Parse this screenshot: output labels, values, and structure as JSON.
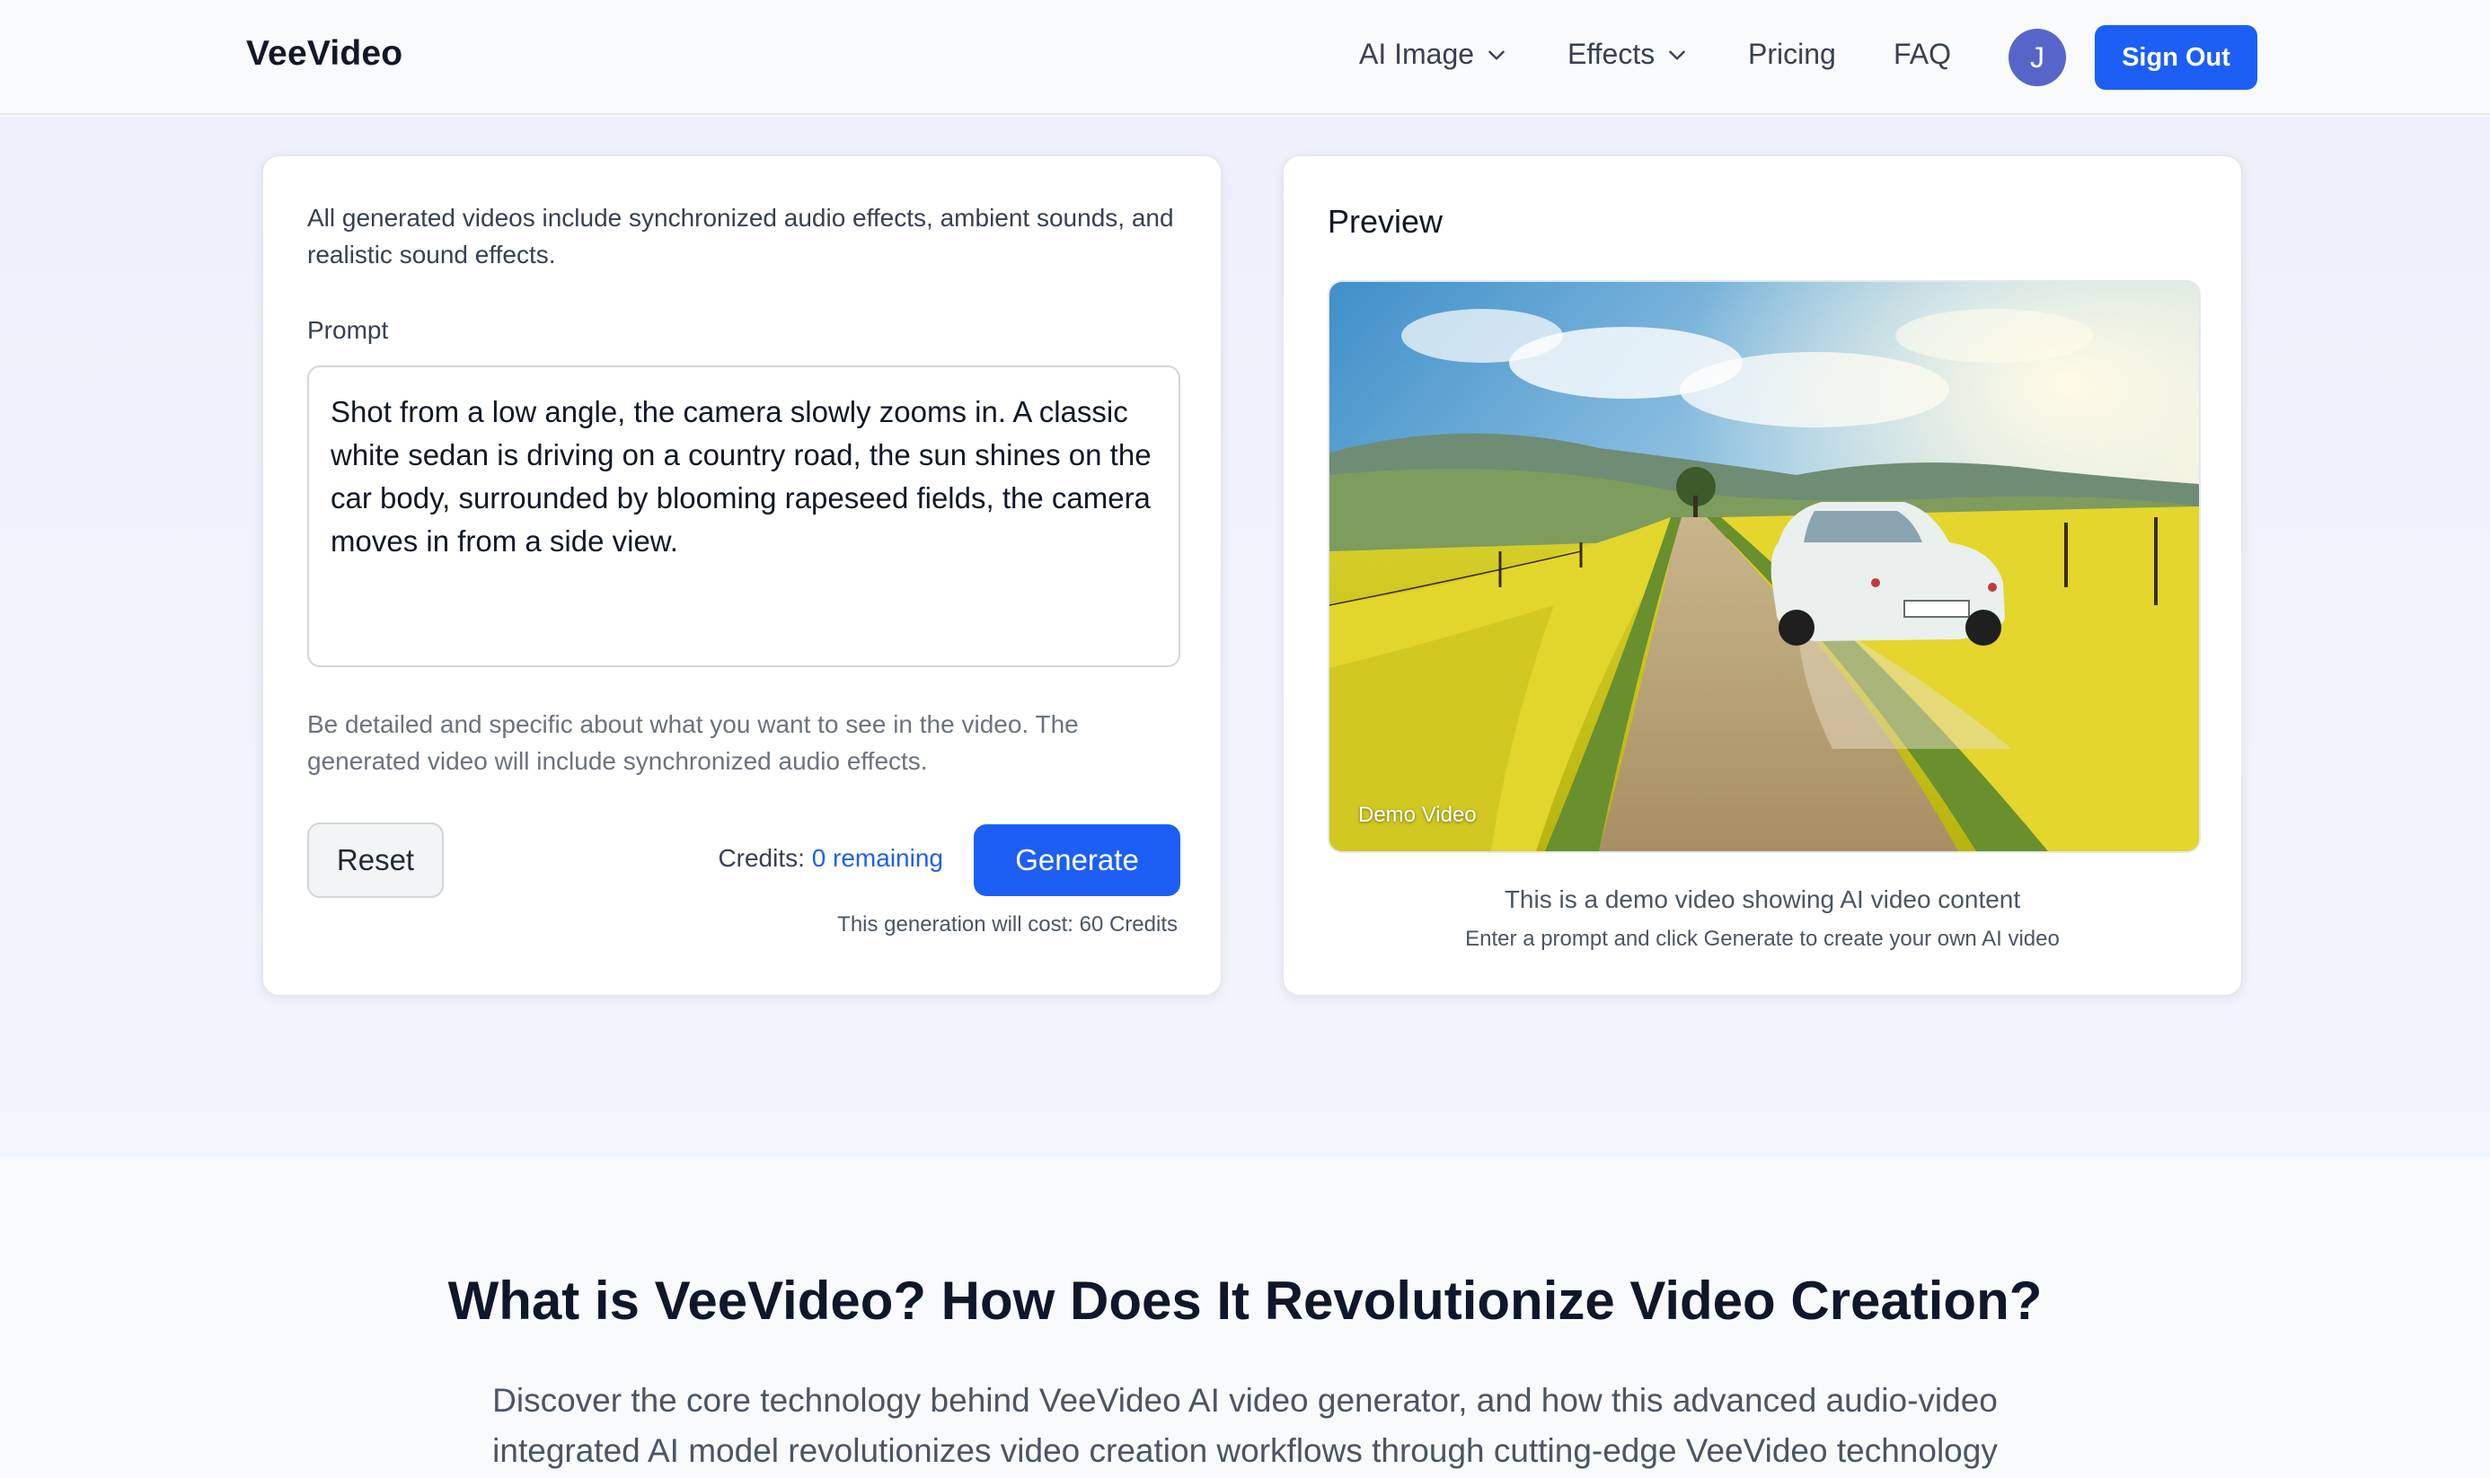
{
  "nav": {
    "logo": "VeeVideo",
    "items": [
      {
        "label": "AI Image",
        "has_dropdown": true
      },
      {
        "label": "Effects",
        "has_dropdown": true
      },
      {
        "label": "Pricing",
        "has_dropdown": false
      },
      {
        "label": "FAQ",
        "has_dropdown": false
      }
    ],
    "avatar_initial": "J",
    "sign_out": "Sign Out"
  },
  "generator": {
    "intro": "All generated videos include synchronized audio effects, ambient sounds, and realistic sound effects.",
    "prompt_label": "Prompt",
    "prompt_value": "Shot from a low angle, the camera slowly zooms in. A classic white sedan is driving on a country road, the sun shines on the car body, surrounded by blooming rapeseed fields, the camera moves in from a side view.",
    "helper": "Be detailed and specific about what you want to see in the video. The generated video will include synchronized audio effects.",
    "reset_label": "Reset",
    "credits_label": "Credits:",
    "credits_remaining": "0 remaining",
    "generate_label": "Generate",
    "cost_text": "This generation will cost: 60 Credits"
  },
  "preview": {
    "title": "Preview",
    "demo_label": "Demo Video",
    "caption": "This is a demo video showing AI video content",
    "subcaption": "Enter a prompt and click Generate to create your own AI video"
  },
  "info": {
    "title": "What is VeeVideo? How Does It Revolutionize Video Creation?",
    "description": "Discover the core technology behind VeeVideo AI video generator, and how this advanced audio-video integrated AI model revolutionizes video creation workflows through cutting-edge VeeVideo technology"
  },
  "colors": {
    "accent": "#1d5ff5",
    "avatar": "#5865c8",
    "text_dark": "#111827",
    "text_muted": "#6b7280"
  }
}
